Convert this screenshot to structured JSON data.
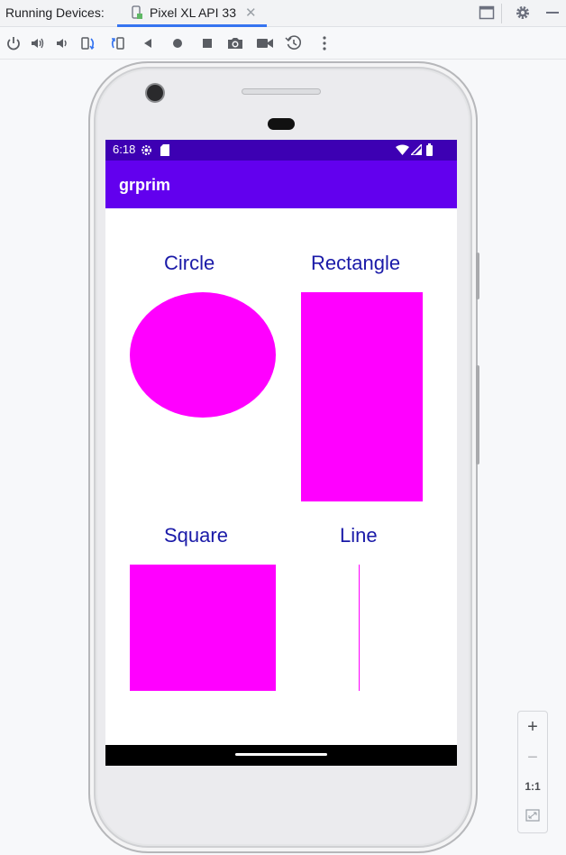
{
  "tool_window": {
    "label": "Running Devices:",
    "tab": {
      "title": "Pixel XL API 33",
      "close": "✕"
    }
  },
  "device": {
    "status_bar": {
      "time": "6:18"
    },
    "app_bar": {
      "title": "grprim"
    },
    "shapes": [
      {
        "label": "Circle"
      },
      {
        "label": "Rectangle"
      },
      {
        "label": "Square"
      },
      {
        "label": "Line"
      }
    ],
    "shape_color": "#ff00ff",
    "label_color": "#1a1aa8",
    "app_bar_color": "#6200ee",
    "status_bar_color": "#3d00b3"
  },
  "zoom": {
    "zoom_in": "+",
    "zoom_out": "−",
    "actual_size": "1:1"
  },
  "toolbar_icons": [
    "power-icon",
    "volume-up-icon",
    "volume-down-icon",
    "rotate-left-icon",
    "rotate-right-icon",
    "back-icon",
    "home-icon",
    "overview-icon",
    "screenshot-icon",
    "screen-record-icon",
    "snapshot-icon",
    "more-icon"
  ]
}
